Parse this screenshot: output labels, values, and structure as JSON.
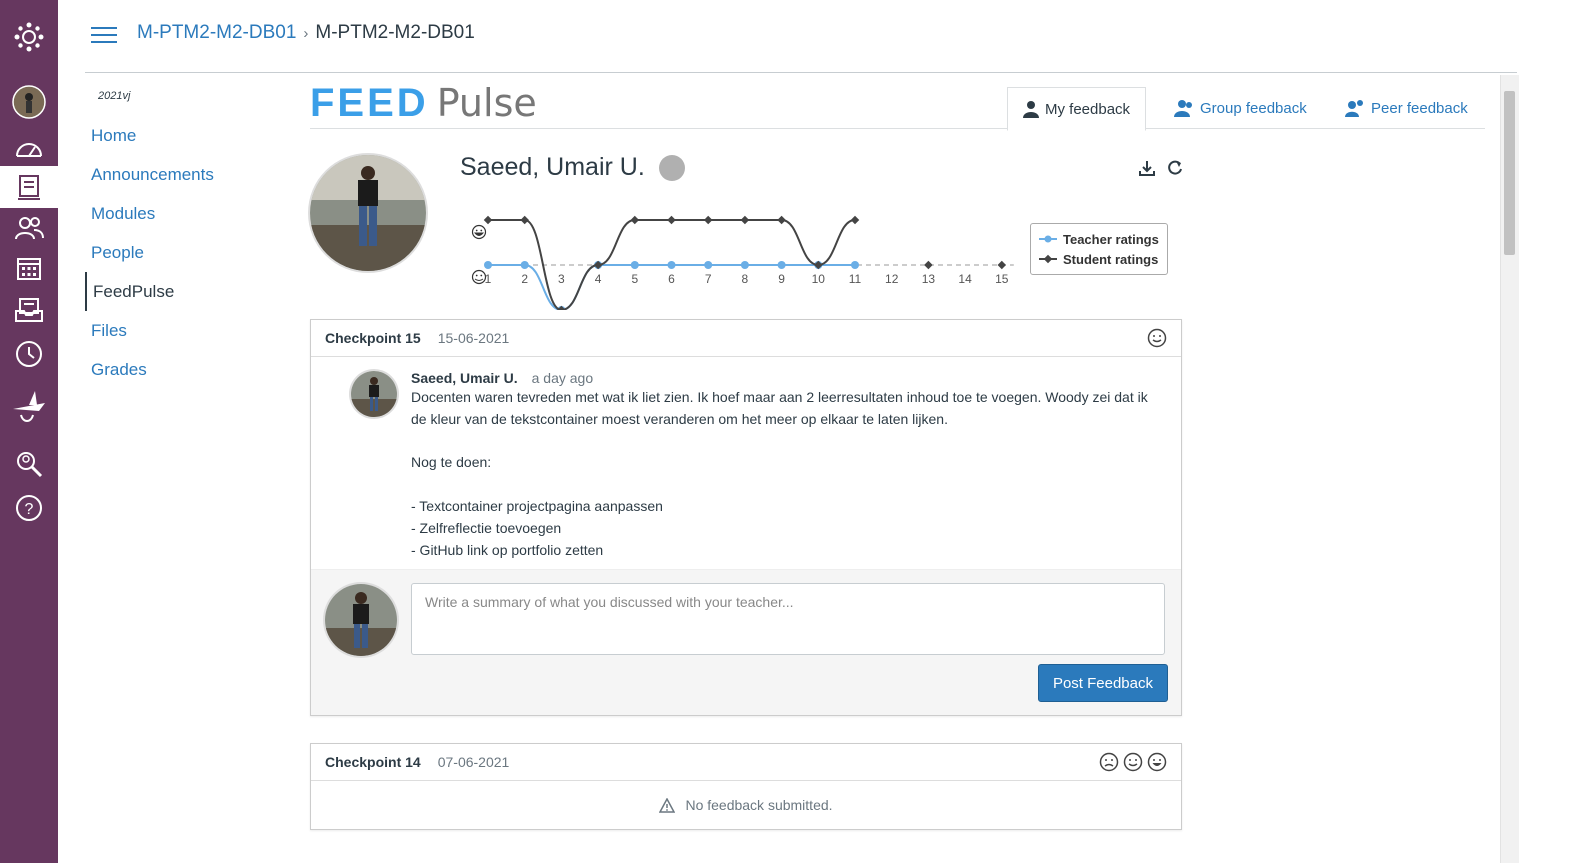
{
  "breadcrumb": {
    "course": "M-PTM2-M2-DB01",
    "page": "M-PTM2-M2-DB01"
  },
  "course_nav": {
    "term": "2021vj",
    "items": [
      "Home",
      "Announcements",
      "Modules",
      "People",
      "FeedPulse",
      "Files",
      "Grades"
    ],
    "active": "FeedPulse"
  },
  "global_nav_icons": [
    "canvas-logo-icon",
    "account-avatar",
    "dashboard-icon",
    "courses-icon",
    "groups-icon",
    "calendar-icon",
    "inbox-icon",
    "history-icon",
    "studio-icon",
    "commons-icon",
    "help-icon"
  ],
  "logo": {
    "feed": "FEED",
    "pulse": "Pulse"
  },
  "tabs": [
    {
      "label": "My feedback",
      "icon": "user-icon",
      "active": true
    },
    {
      "label": "Group feedback",
      "icon": "group-icon",
      "active": false
    },
    {
      "label": "Peer feedback",
      "icon": "peer-icon",
      "active": false
    }
  ],
  "student": {
    "name": "Saeed, Umair U."
  },
  "chart_data": {
    "type": "line",
    "x": [
      1,
      2,
      3,
      4,
      5,
      6,
      7,
      8,
      9,
      10,
      11,
      12,
      13,
      14,
      15
    ],
    "y_levels": [
      "sad",
      "neutral",
      "happy"
    ],
    "series": [
      {
        "name": "Teacher ratings",
        "color": "#6aaee6",
        "values": [
          0,
          0,
          -1,
          0,
          0,
          0,
          0,
          0,
          0,
          0,
          0,
          null,
          null,
          null,
          null
        ]
      },
      {
        "name": "Student ratings",
        "color": "#444444",
        "values": [
          1,
          1,
          -1,
          0,
          1,
          1,
          1,
          1,
          1,
          0,
          1,
          null,
          0,
          null,
          0
        ]
      }
    ],
    "legend": "right"
  },
  "checkpoints": [
    {
      "title": "Checkpoint 15",
      "date": "15-06-2021",
      "comment": {
        "author": "Saeed, Umair U.",
        "time": "a day ago",
        "body": "Docenten waren tevreden met wat ik liet zien. Ik hoef maar aan 2 leerresultaten inhoud toe te voegen. Woody zei dat ik de kleur van de tekstcontainer moest veranderen om het meer op elkaar te laten lijken.\n\nNog te doen:\n\n- Textcontainer projectpagina aanpassen\n- Zelfreflectie toevoegen\n- GitHub link op portfolio zetten"
      },
      "reply_placeholder": "Write a summary of what you discussed with your teacher...",
      "post_label": "Post Feedback"
    },
    {
      "title": "Checkpoint 14",
      "date": "07-06-2021",
      "empty_text": "No feedback submitted."
    }
  ]
}
